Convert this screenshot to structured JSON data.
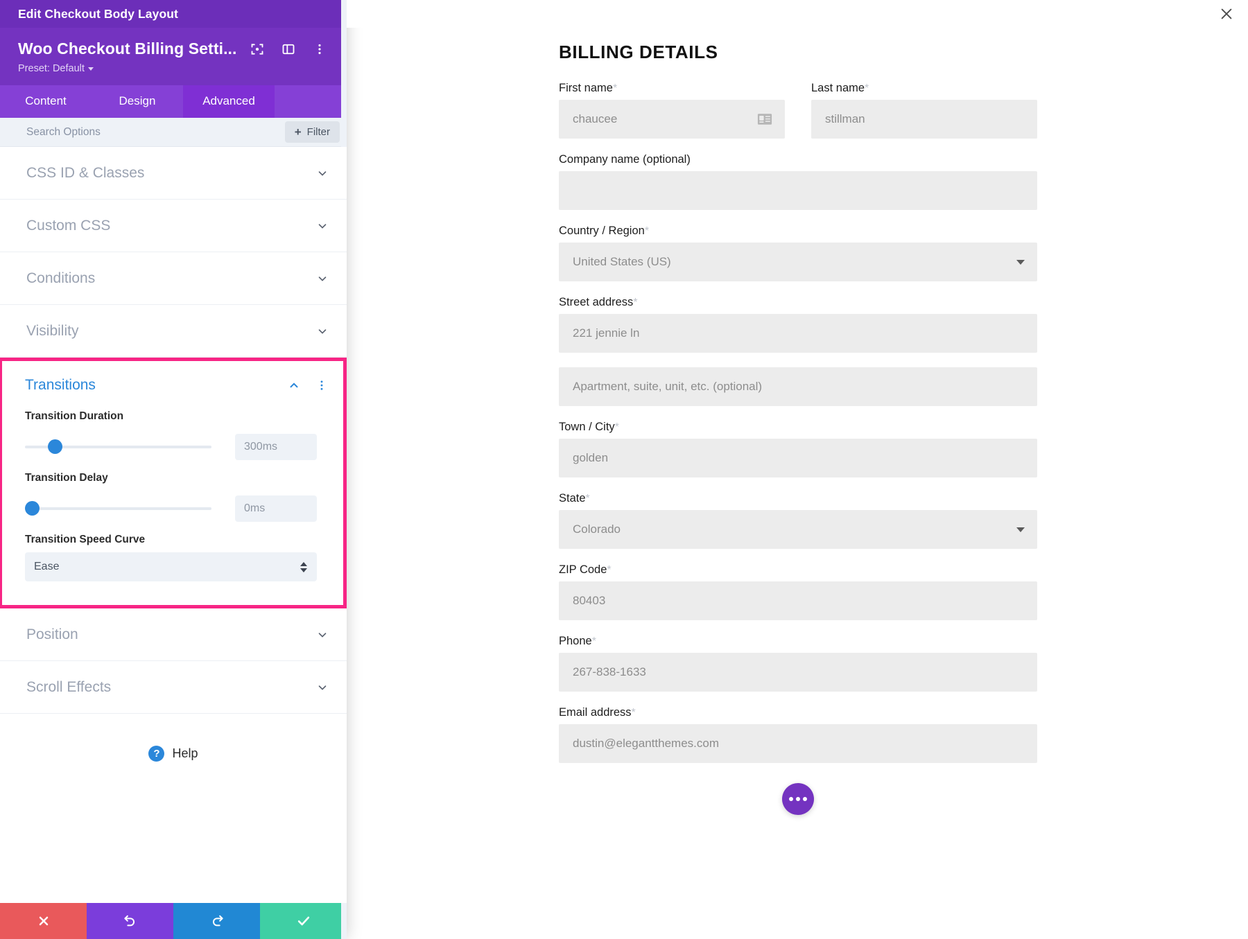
{
  "window": {
    "title": "Edit Checkout Body Layout",
    "close_icon": "close-icon"
  },
  "panel": {
    "module_title": "Woo Checkout Billing Setti...",
    "preset_label": "Preset: Default",
    "header_icons": [
      "focus-target-icon",
      "layout-panel-icon",
      "more-vertical-icon"
    ],
    "tabs": [
      {
        "label": "Content",
        "active": false
      },
      {
        "label": "Design",
        "active": false
      },
      {
        "label": "Advanced",
        "active": true
      }
    ],
    "search": {
      "placeholder": "Search Options",
      "value": "",
      "filter_label": "Filter"
    },
    "sections_above": [
      {
        "label": "CSS ID & Classes",
        "state": "collapsed"
      },
      {
        "label": "Custom CSS",
        "state": "collapsed"
      },
      {
        "label": "Conditions",
        "state": "collapsed"
      },
      {
        "label": "Visibility",
        "state": "collapsed"
      }
    ],
    "transitions": {
      "title": "Transitions",
      "state": "expanded",
      "highlight_color": "#f72585",
      "accent_color": "#2b87da",
      "duration": {
        "label": "Transition Duration",
        "value": "300ms",
        "slider_percent": 16
      },
      "delay": {
        "label": "Transition Delay",
        "value": "0ms",
        "slider_percent": 0
      },
      "speed_curve": {
        "label": "Transition Speed Curve",
        "value": "Ease"
      }
    },
    "sections_below": [
      {
        "label": "Position",
        "state": "collapsed"
      },
      {
        "label": "Scroll Effects",
        "state": "collapsed"
      }
    ],
    "help_label": "Help",
    "actions": [
      {
        "name": "cancel",
        "icon": "close-icon",
        "color": "#e9595b"
      },
      {
        "name": "undo",
        "icon": "undo-icon",
        "color": "#7b3ddb"
      },
      {
        "name": "redo",
        "icon": "redo-icon",
        "color": "#2188d4"
      },
      {
        "name": "save",
        "icon": "check-icon",
        "color": "#3fcfa4"
      }
    ]
  },
  "checkout": {
    "heading": "BILLING DETAILS",
    "first_name": {
      "label": "First name",
      "required": "*",
      "value": "chaucee",
      "icon": "contact-card-icon"
    },
    "last_name": {
      "label": "Last name",
      "required": "*",
      "value": "stillman"
    },
    "company": {
      "label": "Company name (optional)",
      "value": ""
    },
    "country": {
      "label": "Country / Region",
      "required": "*",
      "value": "United States (US)"
    },
    "street": {
      "label": "Street address",
      "required": "*",
      "value": "221 jennie ln"
    },
    "street2": {
      "value": "Apartment, suite, unit, etc. (optional)"
    },
    "city": {
      "label": "Town / City",
      "required": "*",
      "value": "golden"
    },
    "state": {
      "label": "State",
      "required": "*",
      "value": "Colorado"
    },
    "zip": {
      "label": "ZIP Code",
      "required": "*",
      "value": "80403"
    },
    "phone": {
      "label": "Phone",
      "required": "*",
      "value": "267-838-1633"
    },
    "email": {
      "label": "Email address",
      "required": "*",
      "value": "dustin@elegantthemes.com"
    },
    "fab_icon": "more-horizontal-icon"
  }
}
